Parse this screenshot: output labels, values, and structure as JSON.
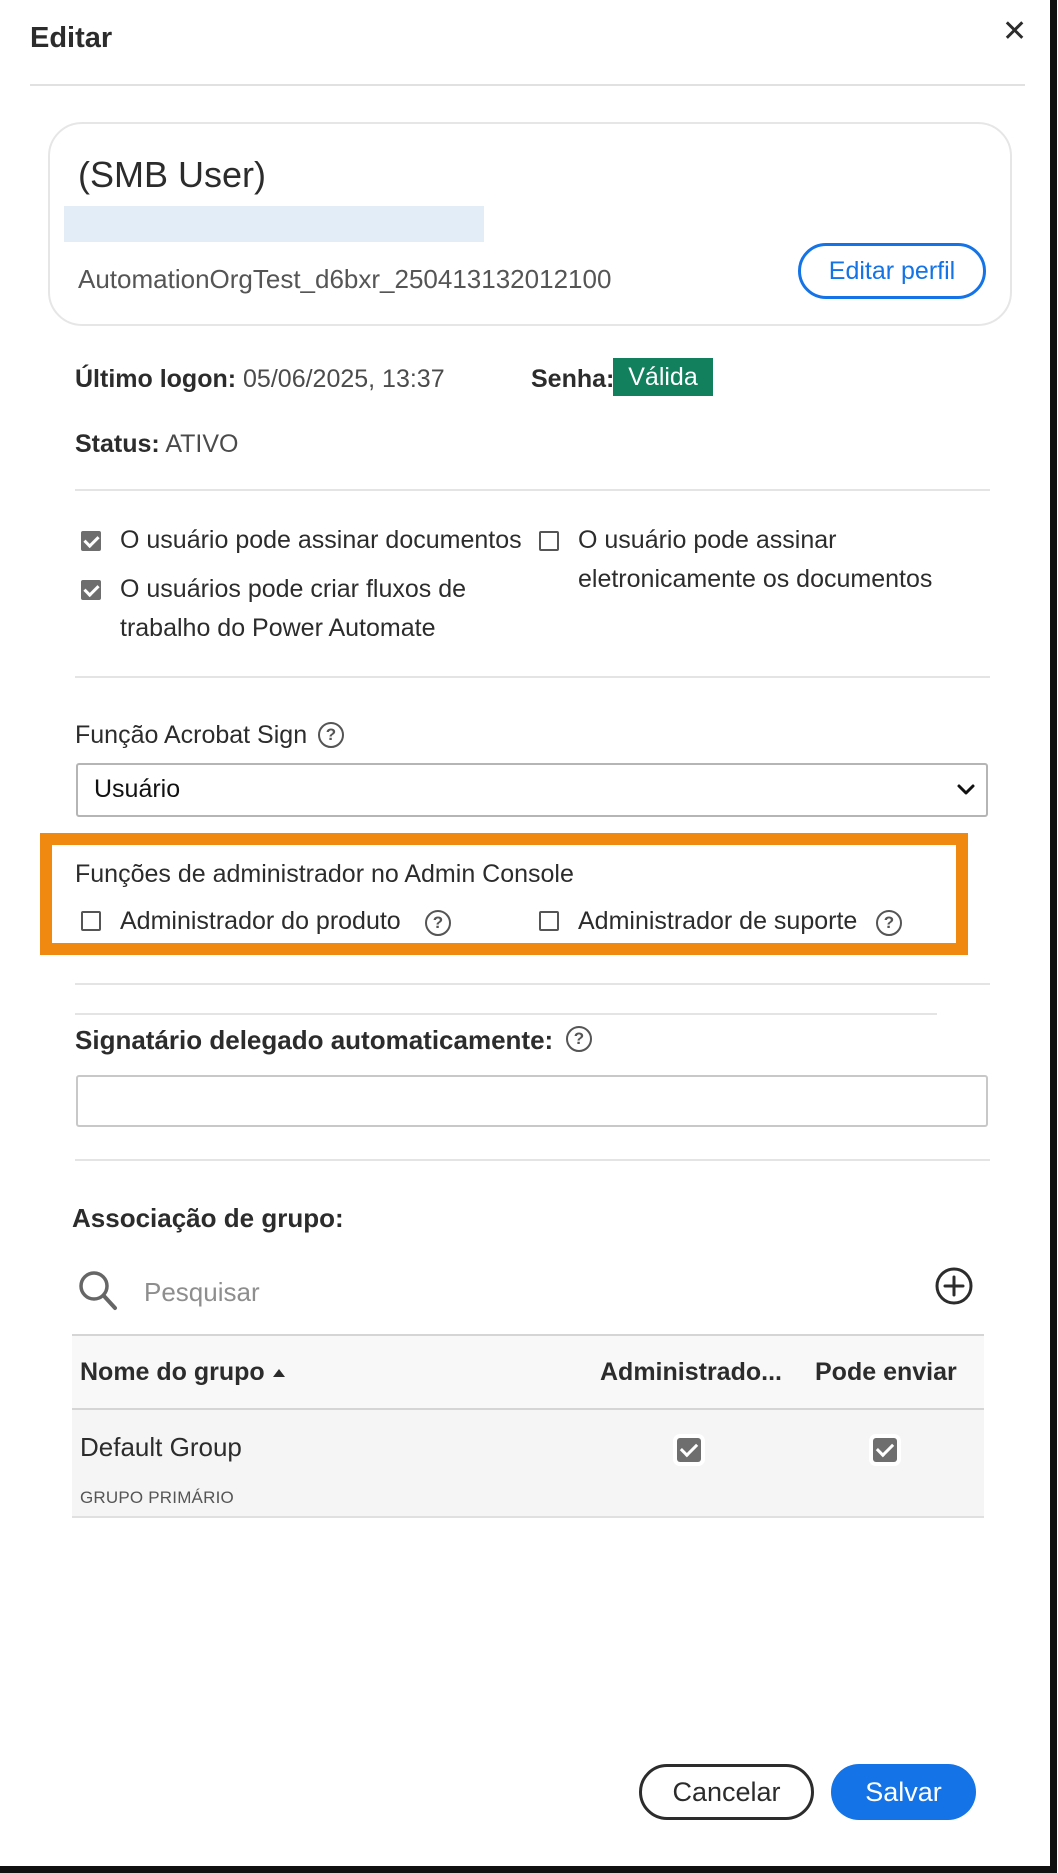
{
  "dialog": {
    "title": "Editar",
    "close_icon": "close-icon"
  },
  "profile": {
    "name": "(SMB User)",
    "org": "AutomationOrgTest_d6bxr_250413132012100",
    "edit_button": "Editar perfil"
  },
  "info": {
    "last_logon_label": "Último logon:",
    "last_logon_value": "05/06/2025, 13:37",
    "password_label": "Senha:",
    "password_badge": "Válida",
    "status_label": "Status:",
    "status_value": "ATIVO"
  },
  "permissions": [
    {
      "label": "O usuário pode assinar documentos",
      "checked": true
    },
    {
      "label_line1": "O usuários pode criar fluxos de",
      "label_line2": "trabalho do Power Automate",
      "checked": true
    },
    {
      "label_line1": "O usuário pode assinar",
      "label_line2": "eletronicamente os documentos",
      "checked": false
    }
  ],
  "role": {
    "label": "Função Acrobat Sign",
    "selected": "Usuário"
  },
  "admin_roles": {
    "title": "Funções de administrador no Admin Console",
    "product_admin": "Administrador do produto",
    "support_admin": "Administrador de suporte"
  },
  "delegate": {
    "label": "Signatário delegado automaticamente:",
    "value": ""
  },
  "groups": {
    "label": "Associação de grupo:",
    "search_placeholder": "Pesquisar",
    "columns": [
      "Nome do grupo",
      "Administrado...",
      "Pode enviar"
    ],
    "rows": [
      {
        "name": "Default Group",
        "subtitle": "GRUPO PRIMÁRIO",
        "admin": true,
        "can_send": true
      }
    ]
  },
  "footer": {
    "cancel": "Cancelar",
    "save": "Salvar"
  },
  "colors": {
    "accent": "#1473e6",
    "valid_badge": "#12805c",
    "highlight": "#f0890f"
  }
}
